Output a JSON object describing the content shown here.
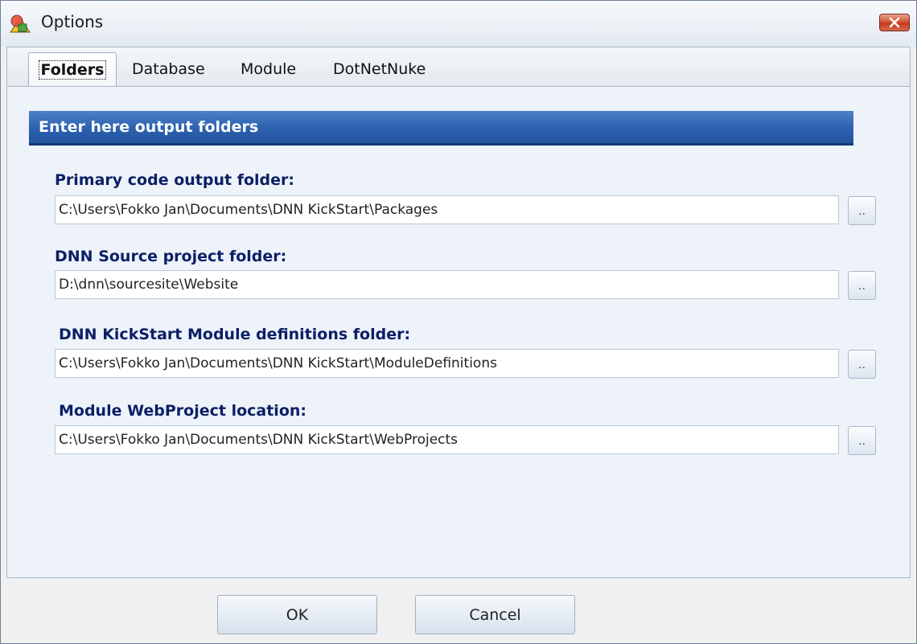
{
  "window": {
    "title": "Options",
    "close_icon": "close-icon"
  },
  "tabs": [
    {
      "label": "Folders",
      "active": true
    },
    {
      "label": "Database",
      "active": false
    },
    {
      "label": "Module",
      "active": false
    },
    {
      "label": "DotNetNuke",
      "active": false
    }
  ],
  "section": {
    "header": "Enter here output folders"
  },
  "fields": [
    {
      "label": "Primary code output folder:",
      "value": "C:\\Users\\Fokko Jan\\Documents\\DNN KickStart\\Packages",
      "browse_label": ".."
    },
    {
      "label": "DNN Source project folder:",
      "value": "D:\\dnn\\sourcesite\\Website",
      "browse_label": ".."
    },
    {
      "label": "DNN KickStart Module definitions folder:",
      "value": "C:\\Users\\Fokko Jan\\Documents\\DNN KickStart\\ModuleDefinitions",
      "browse_label": ".."
    },
    {
      "label": "Module WebProject location:",
      "value": "C:\\Users\\Fokko Jan\\Documents\\DNN KickStart\\WebProjects",
      "browse_label": ".."
    }
  ],
  "buttons": {
    "ok": "OK",
    "cancel": "Cancel"
  },
  "colors": {
    "header_bar": "#2e63b1",
    "label_text": "#0c1f66",
    "close_button": "#c23a1d"
  }
}
